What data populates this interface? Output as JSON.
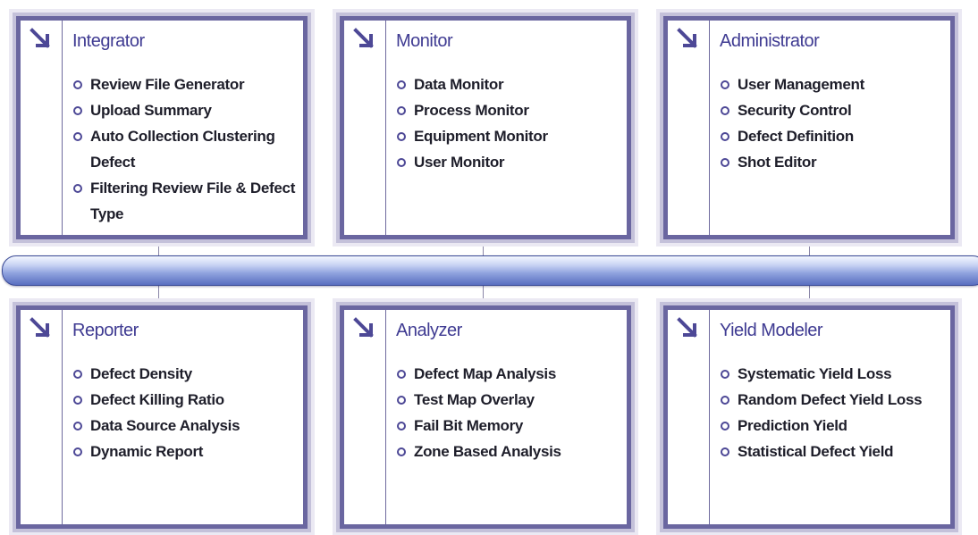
{
  "colors": {
    "panel_border": "#6a66a0",
    "title": "#3f3b92",
    "bullet": "#4d4896",
    "bus": "#8ea1dd"
  },
  "icons": {
    "panel_arrow": "arrow-down-right-icon",
    "list_bullet": "circle-bullet-icon"
  },
  "panels": [
    {
      "title": "Integrator",
      "items": [
        "Review File Generator",
        "Upload Summary",
        "Auto Collection Clustering Defect",
        "Filtering Review File & Defect Type"
      ]
    },
    {
      "title": "Monitor",
      "items": [
        "Data Monitor",
        "Process Monitor",
        "Equipment Monitor",
        "User Monitor"
      ]
    },
    {
      "title": "Administrator",
      "items": [
        "User Management",
        "Security Control",
        "Defect Definition",
        "Shot Editor"
      ]
    },
    {
      "title": "Reporter",
      "items": [
        "Defect Density",
        "Defect Killing Ratio",
        "Data Source Analysis",
        "Dynamic Report"
      ]
    },
    {
      "title": "Analyzer",
      "items": [
        "Defect Map Analysis",
        "Test Map Overlay",
        "Fail Bit Memory",
        "Zone Based Analysis"
      ]
    },
    {
      "title": "Yield Modeler",
      "items": [
        "Systematic Yield Loss",
        "Random Defect Yield Loss",
        "Prediction Yield",
        "Statistical Defect Yield"
      ]
    }
  ]
}
